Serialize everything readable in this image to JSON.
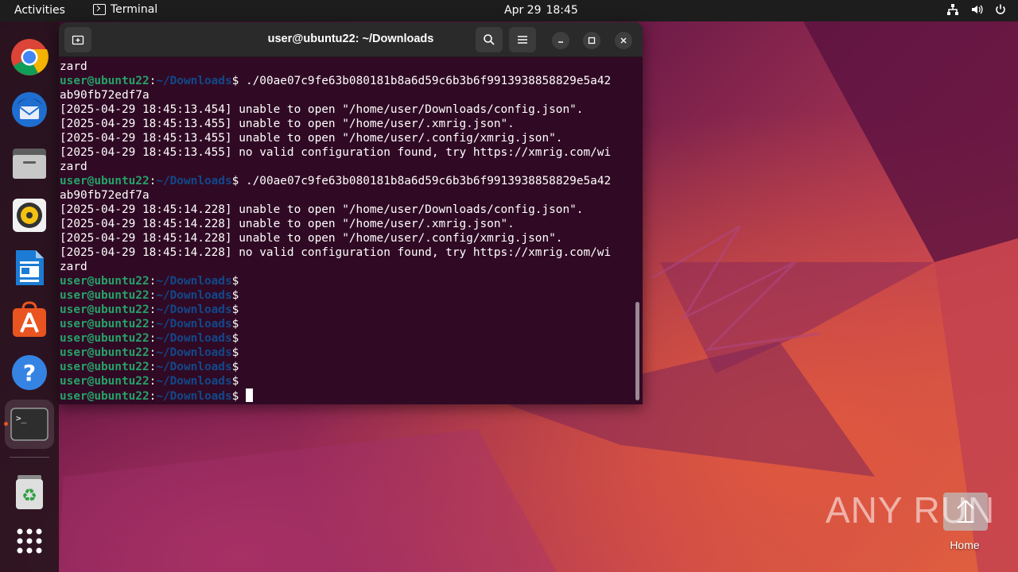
{
  "topbar": {
    "activities": "Activities",
    "app_name": "Terminal",
    "date": "Apr 29",
    "time": "18:45",
    "tray_icons": [
      "network-icon",
      "volume-icon",
      "power-icon"
    ]
  },
  "dock": {
    "items": [
      {
        "name": "chrome",
        "icon": "chrome-icon"
      },
      {
        "name": "thunderbird",
        "icon": "thunderbird-icon"
      },
      {
        "name": "files",
        "icon": "files-icon"
      },
      {
        "name": "rhythmbox",
        "icon": "rhythmbox-icon"
      },
      {
        "name": "libreoffice-writer",
        "icon": "writer-icon"
      },
      {
        "name": "software",
        "icon": "app-center-icon"
      },
      {
        "name": "help",
        "icon": "help-icon"
      },
      {
        "name": "terminal",
        "icon": "terminal-icon",
        "active": true
      },
      {
        "name": "trash",
        "icon": "trash-icon"
      },
      {
        "name": "show-apps",
        "icon": "app-grid-icon"
      }
    ]
  },
  "terminal": {
    "title": "user@ubuntu22: ~/Downloads",
    "prompt_user": "user@ubuntu22",
    "prompt_sep": ":",
    "prompt_path": "~/Downloads",
    "prompt_symbol": "$",
    "lines": [
      {
        "type": "text",
        "text": "zard"
      },
      {
        "type": "prompt",
        "cmd": " ./00ae07c9fe63b080181b8a6d59c6b3b6f9913938858829e5a42"
      },
      {
        "type": "text",
        "text": "ab90fb72edf7a"
      },
      {
        "type": "text",
        "text": "[2025-04-29 18:45:13.454] unable to open \"/home/user/Downloads/config.json\"."
      },
      {
        "type": "text",
        "text": "[2025-04-29 18:45:13.455] unable to open \"/home/user/.xmrig.json\"."
      },
      {
        "type": "text",
        "text": "[2025-04-29 18:45:13.455] unable to open \"/home/user/.config/xmrig.json\"."
      },
      {
        "type": "text",
        "text": "[2025-04-29 18:45:13.455] no valid configuration found, try https://xmrig.com/wi"
      },
      {
        "type": "text",
        "text": "zard"
      },
      {
        "type": "prompt",
        "cmd": " ./00ae07c9fe63b080181b8a6d59c6b3b6f9913938858829e5a42"
      },
      {
        "type": "text",
        "text": "ab90fb72edf7a"
      },
      {
        "type": "text",
        "text": "[2025-04-29 18:45:14.228] unable to open \"/home/user/Downloads/config.json\"."
      },
      {
        "type": "text",
        "text": "[2025-04-29 18:45:14.228] unable to open \"/home/user/.xmrig.json\"."
      },
      {
        "type": "text",
        "text": "[2025-04-29 18:45:14.228] unable to open \"/home/user/.config/xmrig.json\"."
      },
      {
        "type": "text",
        "text": "[2025-04-29 18:45:14.228] no valid configuration found, try https://xmrig.com/wi"
      },
      {
        "type": "text",
        "text": "zard"
      },
      {
        "type": "prompt",
        "cmd": ""
      },
      {
        "type": "prompt",
        "cmd": ""
      },
      {
        "type": "prompt",
        "cmd": ""
      },
      {
        "type": "prompt",
        "cmd": ""
      },
      {
        "type": "prompt",
        "cmd": ""
      },
      {
        "type": "prompt",
        "cmd": ""
      },
      {
        "type": "prompt",
        "cmd": ""
      },
      {
        "type": "prompt",
        "cmd": ""
      },
      {
        "type": "prompt",
        "cmd": "",
        "cursor": true
      }
    ]
  },
  "desktop": {
    "watermark": "ANY RUN",
    "home_label": "Home"
  },
  "colors": {
    "terminal_bg": "#300a24",
    "prompt_user": "#26a269",
    "prompt_path": "#12488b",
    "accent": "#e95420"
  }
}
